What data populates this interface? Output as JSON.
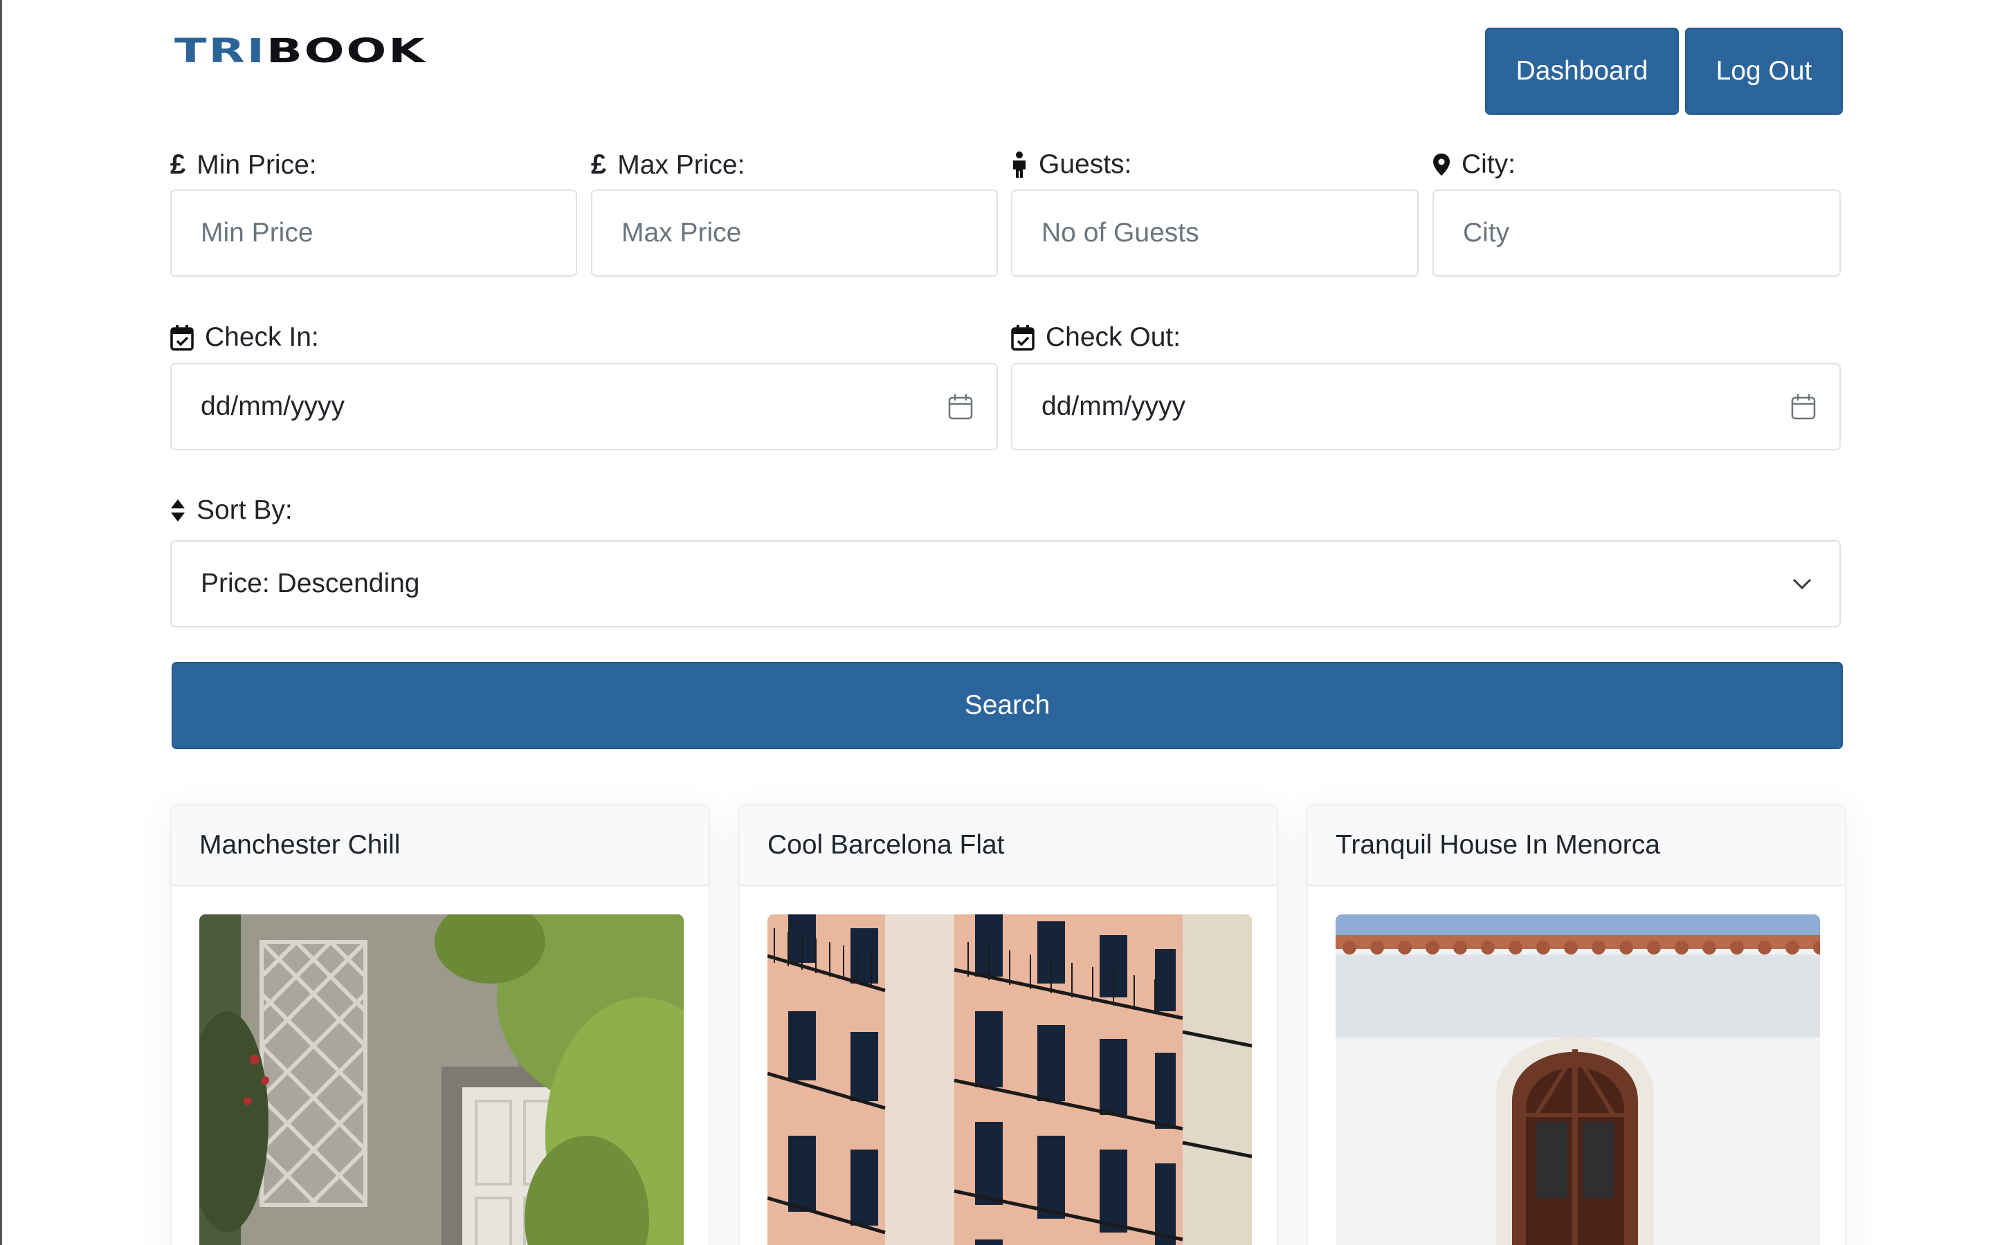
{
  "brand": {
    "part1": "TRI",
    "part2": "BOOK"
  },
  "nav": {
    "dashboard_label": "Dashboard",
    "logout_label": "Log Out"
  },
  "filters": {
    "min_price": {
      "label": "Min Price:",
      "placeholder": "Min Price",
      "icon": "pound-icon"
    },
    "max_price": {
      "label": "Max Price:",
      "placeholder": "Max Price",
      "icon": "pound-icon"
    },
    "guests": {
      "label": "Guests:",
      "placeholder": "No of Guests",
      "icon": "person-icon"
    },
    "city": {
      "label": "City:",
      "placeholder": "City",
      "icon": "map-pin-icon"
    },
    "check_in": {
      "label": "Check In:",
      "value": "dd/mm/yyyy",
      "icon": "calendar-check-icon"
    },
    "check_out": {
      "label": "Check Out:",
      "value": "dd/mm/yyyy",
      "icon": "calendar-check-icon"
    },
    "sort_by": {
      "label": "Sort By:",
      "selected": "Price: Descending",
      "icon": "sort-icon"
    }
  },
  "search": {
    "label": "Search"
  },
  "listings": [
    {
      "title": "Manchester Chill",
      "image": "stone-wall-door-photo"
    },
    {
      "title": "Cool Barcelona Flat",
      "image": "apartment-balconies-photo"
    },
    {
      "title": "Tranquil House In Menorca",
      "image": "white-house-arched-door-photo"
    }
  ],
  "colors": {
    "primary": "#2c659b",
    "brand_blue": "#2c6399",
    "brand_dark": "#0f1115"
  }
}
